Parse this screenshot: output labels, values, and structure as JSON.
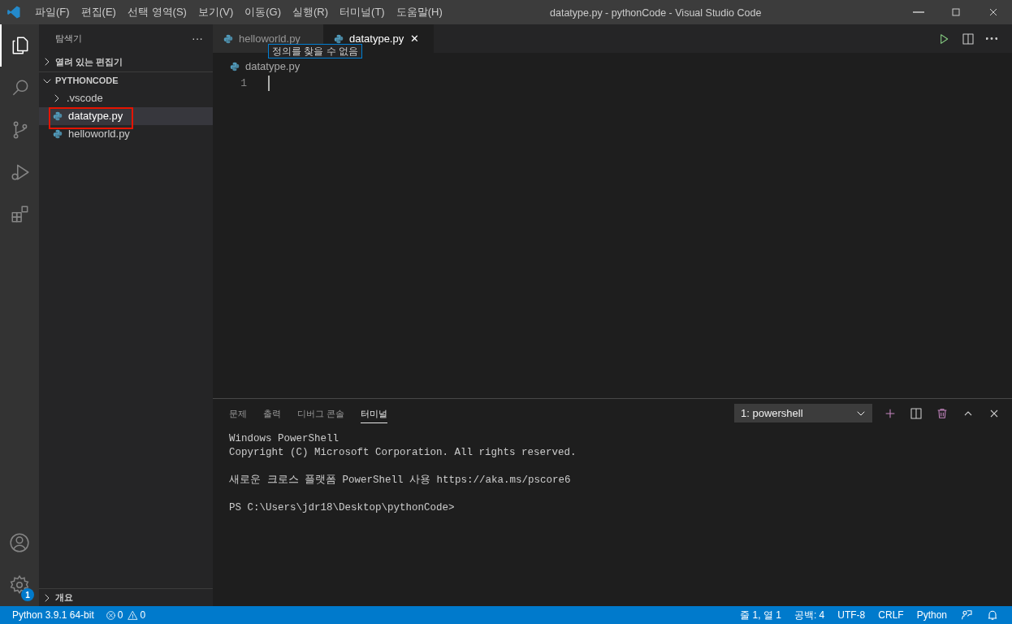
{
  "window": {
    "title": "datatype.py - pythonCode - Visual Studio Code"
  },
  "menu": [
    "파일(F)",
    "편집(E)",
    "선택 영역(S)",
    "보기(V)",
    "이동(G)",
    "실행(R)",
    "터미널(T)",
    "도움말(H)"
  ],
  "activity_bar": [
    {
      "kind": "files",
      "selected": true
    },
    {
      "kind": "search",
      "selected": false
    },
    {
      "kind": "git",
      "selected": false
    },
    {
      "kind": "debug",
      "selected": false
    },
    {
      "kind": "extensions",
      "selected": false
    }
  ],
  "settings_badge": "1",
  "sidebar": {
    "title": "탐색기",
    "more": "···",
    "sections": [
      {
        "label": "열려 있는 편집기",
        "expanded": false
      },
      {
        "label": "PYTHONCODE",
        "expanded": true
      }
    ],
    "items": [
      {
        "label": ".vscode",
        "kind": "folder",
        "expanded": false,
        "selected": false
      },
      {
        "label": "datatype.py",
        "kind": "python",
        "selected": true,
        "highlighted": true
      },
      {
        "label": "helloworld.py",
        "kind": "python",
        "selected": false
      }
    ],
    "outline": {
      "label": "개요",
      "expanded": false
    }
  },
  "tabs": [
    {
      "label": "helloworld.py",
      "selected": false
    },
    {
      "label": "datatype.py",
      "selected": true,
      "close": "✕"
    }
  ],
  "breadcrumb": "datatype.py",
  "tooltip": "정의를 찾을 수 없음",
  "editor": {
    "line_numbers": [
      "1"
    ]
  },
  "panel": {
    "tabs": [
      {
        "label": "문제",
        "selected": false
      },
      {
        "label": "출력",
        "selected": false
      },
      {
        "label": "디버그 콘솔",
        "selected": false
      },
      {
        "label": "터미널",
        "selected": true
      }
    ],
    "terminal_select": "1: powershell",
    "terminal_blocks": [
      [
        "Windows PowerShell",
        "Copyright (C) Microsoft Corporation. All rights reserved."
      ],
      [
        "새로운 크로스 플랫폼 PowerShell 사용 https://aka.ms/pscore6"
      ],
      [
        "PS C:\\Users\\jdr18\\Desktop\\pythonCode>"
      ]
    ]
  },
  "status_bar": {
    "left": [
      "Python 3.9.1 64-bit"
    ],
    "errors": "0",
    "warnings": "0",
    "right": [
      "줄 1, 열 1",
      "공백: 4",
      "UTF-8",
      "CRLF",
      "Python"
    ]
  }
}
